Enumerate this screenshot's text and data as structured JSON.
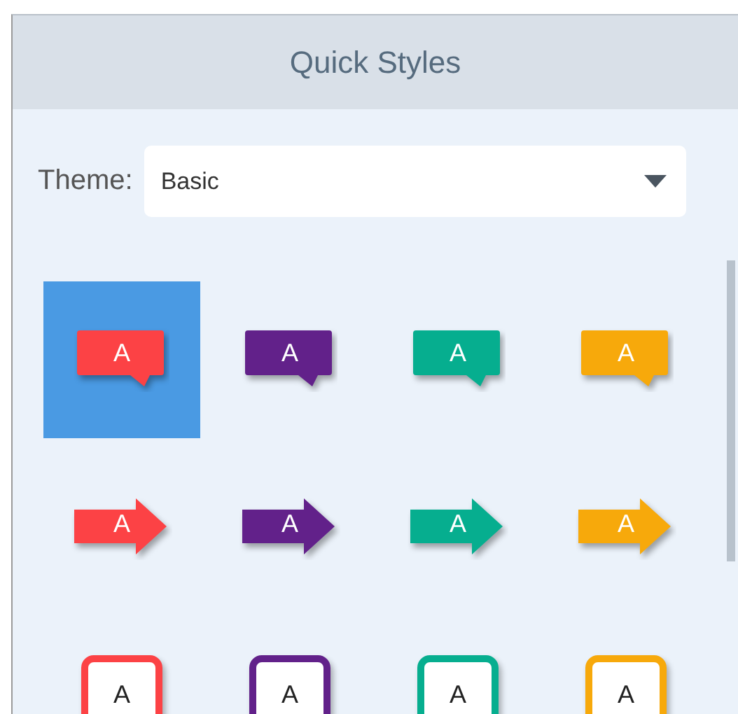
{
  "panel": {
    "title": "Quick Styles"
  },
  "theme": {
    "label": "Theme:",
    "value": "Basic"
  },
  "styles": [
    {
      "kind": "callout",
      "color": "#fc4245",
      "label": "A",
      "selected": true
    },
    {
      "kind": "callout",
      "color": "#62218a",
      "label": "A",
      "selected": false
    },
    {
      "kind": "callout",
      "color": "#06ae8f",
      "label": "A",
      "selected": false
    },
    {
      "kind": "callout",
      "color": "#f7a90b",
      "label": "A",
      "selected": false
    },
    {
      "kind": "arrow",
      "color": "#fc4245",
      "label": "A",
      "selected": false
    },
    {
      "kind": "arrow",
      "color": "#62218a",
      "label": "A",
      "selected": false
    },
    {
      "kind": "arrow",
      "color": "#06ae8f",
      "label": "A",
      "selected": false
    },
    {
      "kind": "arrow",
      "color": "#f7a90b",
      "label": "A",
      "selected": false
    },
    {
      "kind": "box",
      "color": "#fc4245",
      "label": "A",
      "selected": false
    },
    {
      "kind": "box",
      "color": "#62218a",
      "label": "A",
      "selected": false
    },
    {
      "kind": "box",
      "color": "#06ae8f",
      "label": "A",
      "selected": false
    },
    {
      "kind": "box",
      "color": "#f7a90b",
      "label": "A",
      "selected": false
    }
  ]
}
